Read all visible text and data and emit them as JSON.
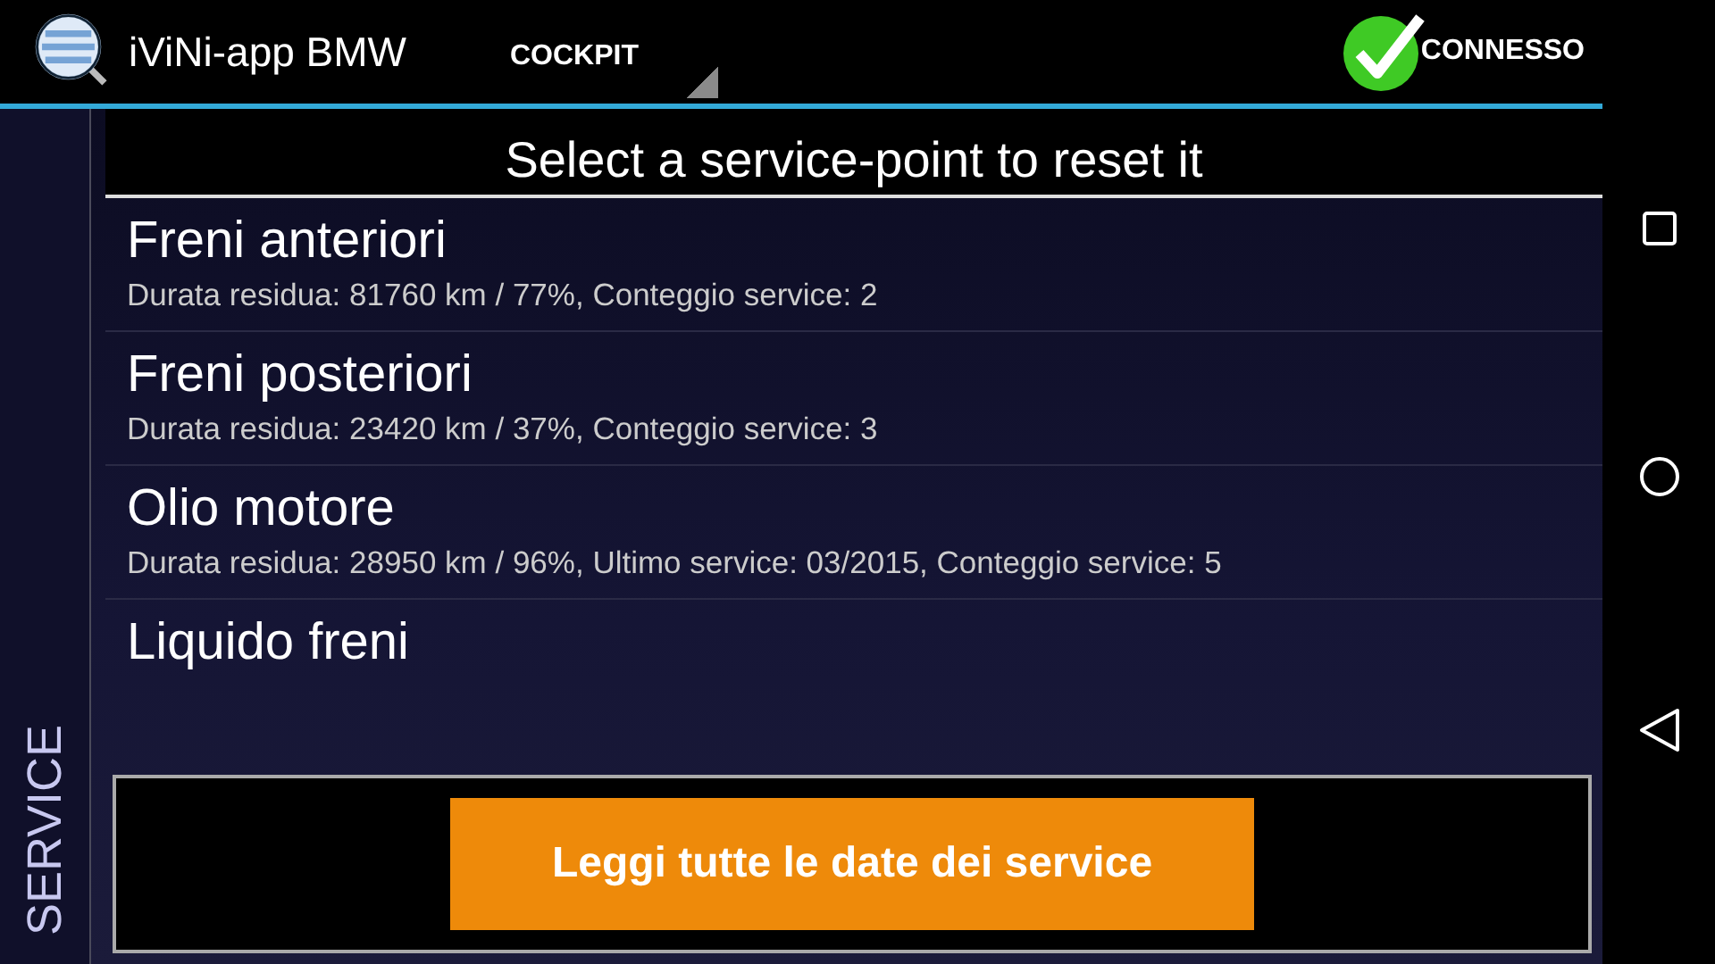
{
  "app_bar": {
    "title": "iViNi-app BMW",
    "mode_dropdown": "COCKPIT",
    "status": "CONNESSO",
    "connected": true
  },
  "side_tab": "SERVICE",
  "heading": "Select a service-point to reset it",
  "services": [
    {
      "name": "Freni anteriori",
      "detail": "Durata residua: 81760 km / 77%, Conteggio service: 2"
    },
    {
      "name": "Freni posteriori",
      "detail": "Durata residua: 23420 km / 37%, Conteggio service: 3"
    },
    {
      "name": "Olio motore",
      "detail": "Durata residua: 28950 km / 96%, Ultimo service: 03/2015, Conteggio service: 5"
    },
    {
      "name": "Liquido freni"
    }
  ],
  "action_button": "Leggi tutte le date dei service"
}
